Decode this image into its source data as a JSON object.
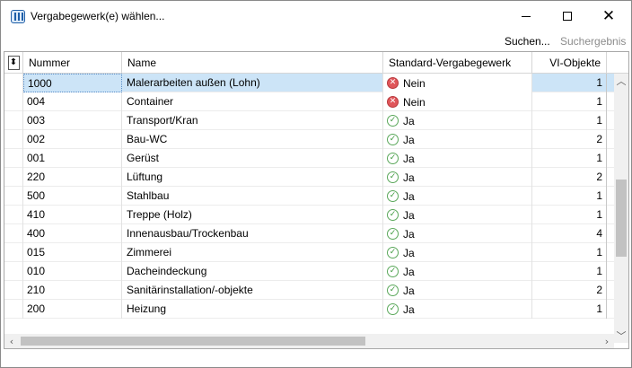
{
  "window": {
    "title": "Vergabegewerk(e) wählen...",
    "controls": {
      "minimize": "minimize-icon",
      "maximize": "maximize-icon",
      "close": "✕"
    }
  },
  "toolbar": {
    "search_label": "Suchen...",
    "results_label": "Suchergebnis"
  },
  "grid": {
    "columns": {
      "nummer": "Nummer",
      "name": "Name",
      "standard": "Standard-Vergabegewerk",
      "vi_objekte": "VI-Objekte"
    },
    "rows": [
      {
        "nummer": "1000",
        "name": "Malerarbeiten außen (Lohn)",
        "standard": "Nein",
        "vi": "1"
      },
      {
        "nummer": "004",
        "name": "Container",
        "standard": "Nein",
        "vi": "1"
      },
      {
        "nummer": "003",
        "name": "Transport/Kran",
        "standard": "Ja",
        "vi": "1"
      },
      {
        "nummer": "002",
        "name": "Bau-WC",
        "standard": "Ja",
        "vi": "2"
      },
      {
        "nummer": "001",
        "name": "Gerüst",
        "standard": "Ja",
        "vi": "1"
      },
      {
        "nummer": "220",
        "name": "Lüftung",
        "standard": "Ja",
        "vi": "2"
      },
      {
        "nummer": "500",
        "name": "Stahlbau",
        "standard": "Ja",
        "vi": "1"
      },
      {
        "nummer": "410",
        "name": "Treppe (Holz)",
        "standard": "Ja",
        "vi": "1"
      },
      {
        "nummer": "400",
        "name": "Innenausbau/Trockenbau",
        "standard": "Ja",
        "vi": "4"
      },
      {
        "nummer": "015",
        "name": "Zimmerei",
        "standard": "Ja",
        "vi": "1"
      },
      {
        "nummer": "010",
        "name": "Dacheindeckung",
        "standard": "Ja",
        "vi": "1"
      },
      {
        "nummer": "210",
        "name": "Sanitärinstallation/-objekte",
        "standard": "Ja",
        "vi": "2"
      },
      {
        "nummer": "200",
        "name": "Heizung",
        "standard": "Ja",
        "vi": "1"
      }
    ],
    "selected_index": 0
  },
  "colors": {
    "selection": "#cce4f7",
    "no_icon": "#e0565a",
    "yes_icon": "#5ba85b",
    "disabled_text": "#8c8c8c"
  }
}
